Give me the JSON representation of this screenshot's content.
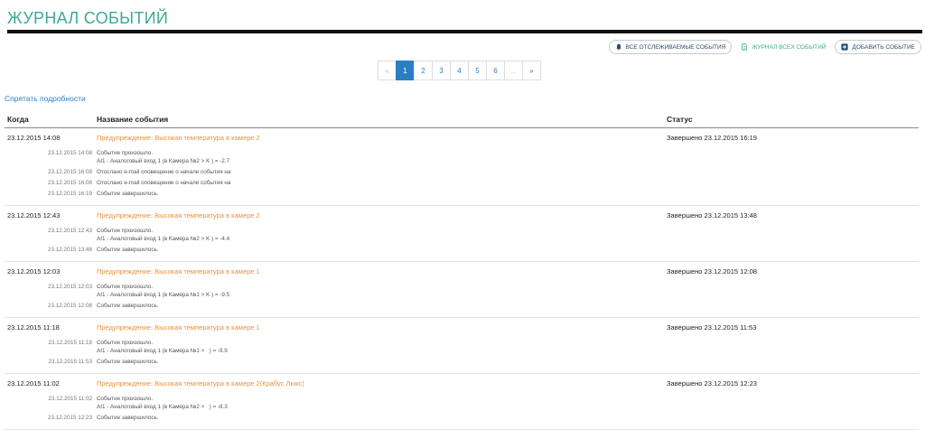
{
  "page_title": "ЖУРНАЛ СОБЫТИЙ",
  "toolbar": {
    "all_tracked": "ВСЕ ОТСЛЕЖИВАЕМЫЕ СОБЫТИЯ",
    "all_log": "ЖУРНАЛ ВСЕХ СОБЫТИЙ",
    "add_event": "ДОБАВИТЬ СОБЫТИЕ"
  },
  "pagination": {
    "prev": "«",
    "pages": [
      "1",
      "2",
      "3",
      "4",
      "5",
      "6"
    ],
    "ellipsis": "...",
    "next": "»",
    "active": "1"
  },
  "hide_details": "Спрятать подробности",
  "columns": {
    "when": "Когда",
    "name": "Название события",
    "status": "Статус"
  },
  "events": [
    {
      "when": "23.12.2015 14:08",
      "name": "Предупреждение: Высокая температура в камере 2",
      "status": "Завершено 23.12.2015 16:19",
      "details": [
        {
          "time": "23.12.2015 14:08",
          "text": "Событие произошло.\nAI1 - Аналоговый вход 1 (в Камера №2 > K ) = -2.7"
        },
        {
          "time": "23.12.2015 16:08",
          "text": "Отослано e-mail оповещение о начале события на"
        },
        {
          "time": "23.12.2015 16:08",
          "text": "Отослано e-mail оповещение о начале события на"
        },
        {
          "time": "23.12.2015 16:19",
          "text": "Событие завершилось."
        }
      ]
    },
    {
      "when": "23.12.2015 12:43",
      "name": "Предупреждение: Высокая температура в камере 2",
      "status": "Завершено 23.12.2015 13:48",
      "details": [
        {
          "time": "23.12.2015 12:43",
          "text": "Событие произошло.\nAI1 - Аналоговый вход 1 (в Камера №2 > K ) = -4.4"
        },
        {
          "time": "23.12.2015 13:48",
          "text": "Событие завершилось."
        }
      ]
    },
    {
      "when": "23.12.2015 12:03",
      "name": "Предупреждение: Высокая температура в камере 1",
      "status": "Завершено 23.12.2015 12:08",
      "details": [
        {
          "time": "23.12.2015 12:03",
          "text": "Событие произошло.\nAI1 - Аналоговый вход 1 (в Камера №1 > K ) = -9.5"
        },
        {
          "time": "23.12.2015 12:08",
          "text": "Событие завершилось."
        }
      ]
    },
    {
      "when": "23.12.2015 11:18",
      "name": "Предупреждение: Высокая температура в камере 1",
      "status": "Завершено 23.12.2015 11:53",
      "details": [
        {
          "time": "23.12.2015 11:18",
          "text": "Событие произошло.\nAI1 - Аналоговый вход 1 (в Камера №1 >   ) = -9.9"
        },
        {
          "time": "23.12.2015 11:53",
          "text": "Событие завершилось."
        }
      ]
    },
    {
      "when": "23.12.2015 11:02",
      "name": "Предупреждение: Высокая температура в камере 2(Крабус Люкс)",
      "status": "Завершено 23.12.2015 12:23",
      "details": [
        {
          "time": "23.12.2015 11:02",
          "text": "Событие произошло.\nAI1 - Аналоговый вход 1 (в Камера №2 >   ) = -8.3"
        },
        {
          "time": "23.12.2015 12:23",
          "text": "Событие завершилось."
        }
      ]
    }
  ],
  "icons": {
    "bell": "bell-icon",
    "doc": "document-icon",
    "plus": "plus-square-icon"
  },
  "colors": {
    "accent": "#3cab96",
    "link": "#2a7fc3",
    "event_name": "#e8913a"
  }
}
